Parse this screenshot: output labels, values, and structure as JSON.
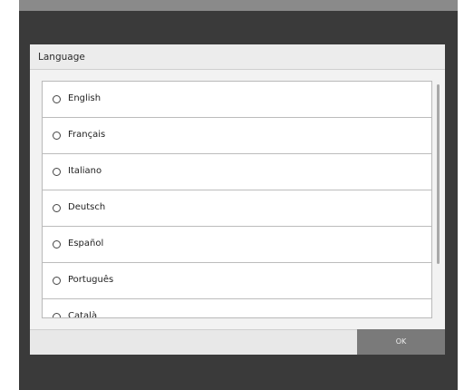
{
  "dialog": {
    "title": "Language",
    "ok_label": "OK"
  },
  "languages": [
    {
      "label": "English",
      "selected": false
    },
    {
      "label": "Français",
      "selected": false
    },
    {
      "label": "Italiano",
      "selected": false
    },
    {
      "label": "Deutsch",
      "selected": false
    },
    {
      "label": "Español",
      "selected": false
    },
    {
      "label": "Português",
      "selected": false
    },
    {
      "label": "Català",
      "selected": false
    }
  ],
  "colors": {
    "backdrop": "#3a3a3a",
    "ok_button": "#7a7a7a"
  }
}
